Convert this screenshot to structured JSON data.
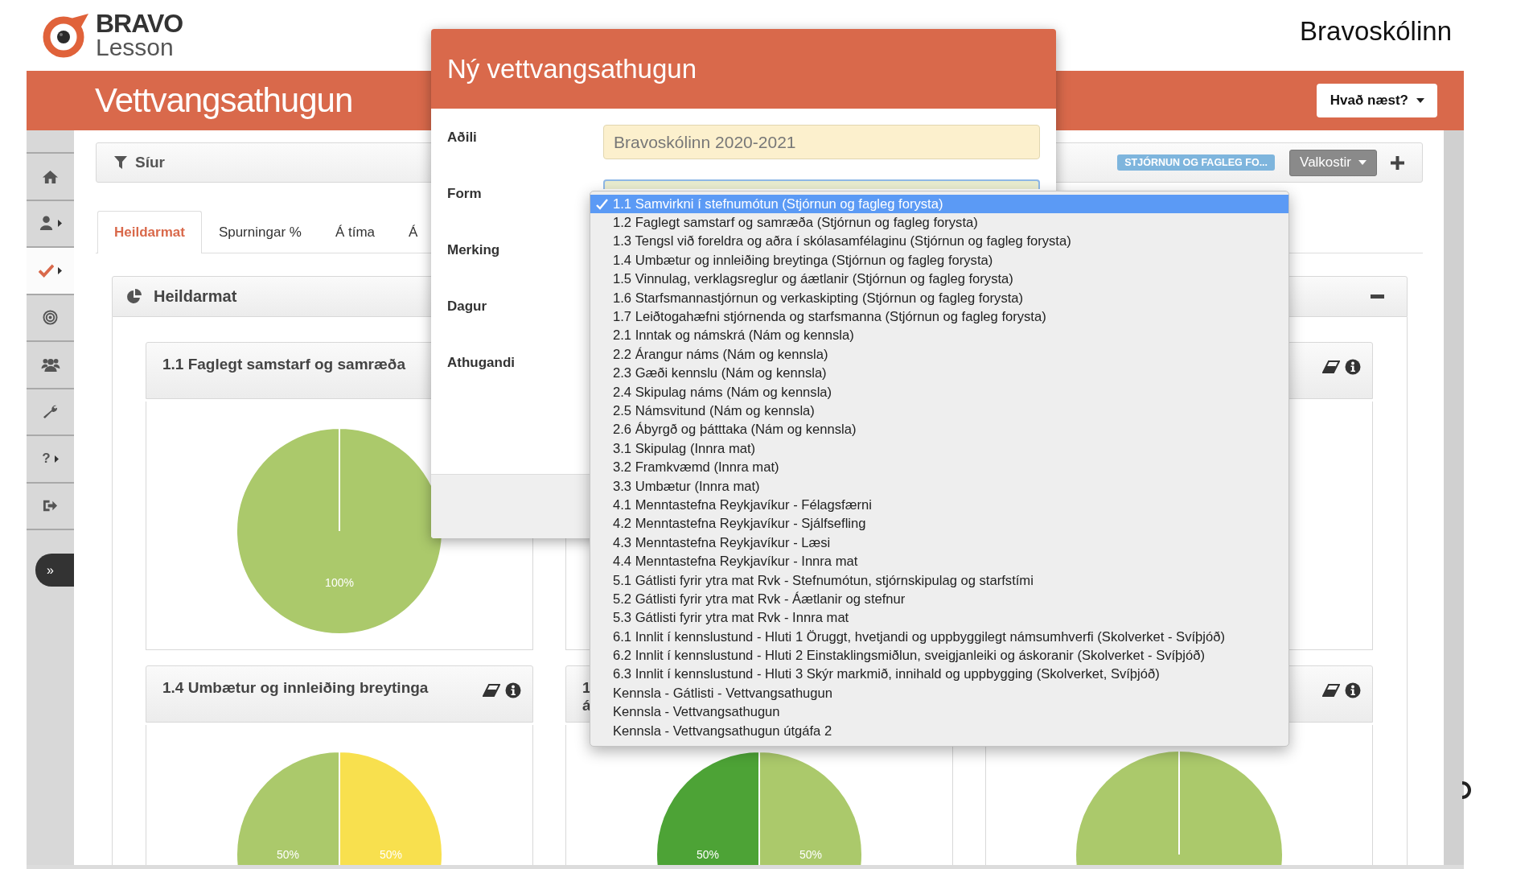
{
  "logo": {
    "line1": "BRAVO",
    "line2": "Lesson"
  },
  "school_name": "Bravoskólinn",
  "page_title": "Vettvangsathugun",
  "next_button": "Hvað næst?",
  "sidebar": {
    "items": [
      {
        "selected": false,
        "submenu": false
      },
      {
        "selected": false,
        "submenu": true
      },
      {
        "selected": true,
        "submenu": true
      },
      {
        "selected": false,
        "submenu": false
      },
      {
        "selected": false,
        "submenu": false
      },
      {
        "selected": false,
        "submenu": false
      },
      {
        "label": "?",
        "selected": false,
        "submenu": true
      },
      {
        "selected": false,
        "submenu": false
      }
    ],
    "expand_button": "»"
  },
  "filter_panel": {
    "title": "Síur",
    "tag": "STJÓRNUN OG FAGLEG FO...",
    "options_button": "Valkostir"
  },
  "tabs": [
    {
      "label": "Heildarmat",
      "selected": true
    },
    {
      "label": "Spurningar %",
      "selected": false
    },
    {
      "label": "Á tíma",
      "selected": false
    },
    {
      "label": "Á",
      "selected": false
    }
  ],
  "summary_panel": {
    "title": "Heildarmat",
    "cards": [
      {
        "kind": "pie_chart",
        "title": "1.1 Faglegt samstarf og samræða",
        "tools": false,
        "chart_data": {
          "type": "pie",
          "values": [
            100
          ],
          "colors": [
            "#abc96b"
          ],
          "value_labels": [
            "100%"
          ]
        }
      },
      {
        "kind": "empty"
      },
      {
        "kind": "empty",
        "tools": true
      },
      {
        "kind": "pie_chart",
        "title": "1.4 Umbætur og innleiðing breytinga",
        "tools": true,
        "chart_data": {
          "type": "pie",
          "values": [
            50,
            50
          ],
          "colors": [
            "#f8e04e",
            "#abc96b"
          ],
          "value_labels": [
            "50%",
            "50%"
          ]
        }
      },
      {
        "kind": "pie_chart",
        "title_fragments": [
          "1",
          "á"
        ],
        "tools": false,
        "chart_data": {
          "type": "pie",
          "values": [
            50,
            50
          ],
          "colors": [
            "#abc96b",
            "#4da336"
          ],
          "value_labels": [
            "50%",
            "50%"
          ]
        }
      },
      {
        "kind": "pie_picture",
        "tools": true
      }
    ]
  },
  "modal": {
    "title": "Ný vettvangsathugun",
    "fields": [
      {
        "label": "Aðili",
        "kind": "text",
        "value": "Bravoskólinn 2020-2021"
      },
      {
        "label": "Form",
        "kind": "select"
      },
      {
        "label": "Merking",
        "kind": "covered"
      },
      {
        "label": "Dagur",
        "kind": "covered"
      },
      {
        "label": "Athugandi",
        "kind": "covered"
      }
    ]
  },
  "dropdown": {
    "options": [
      {
        "label": "1.1 Samvirkni í stefnumótun (Stjórnun og fagleg forysta)",
        "selected": true
      },
      {
        "label": "1.2 Faglegt samstarf og samræða (Stjórnun og fagleg forysta)",
        "selected": false
      },
      {
        "label": "1.3 Tengsl við foreldra og aðra í skólasamfélaginu (Stjórnun og fagleg forysta)",
        "selected": false
      },
      {
        "label": "1.4 Umbætur og innleiðing breytinga (Stjórnun og fagleg forysta)",
        "selected": false
      },
      {
        "label": "1.5 Vinnulag, verklagsreglur og áætlanir (Stjórnun og fagleg forysta)",
        "selected": false
      },
      {
        "label": "1.6 Starfsmannastjórnun og verkaskipting (Stjórnun og fagleg forysta)",
        "selected": false
      },
      {
        "label": "1.7 Leiðtogahæfni stjórnenda og starfsmanna (Stjórnun og fagleg forysta)",
        "selected": false
      },
      {
        "label": "2.1 Inntak og námskrá (Nám og kennsla)",
        "selected": false
      },
      {
        "label": "2.2 Árangur náms (Nám og kennsla)",
        "selected": false
      },
      {
        "label": "2.3 Gæði kennslu (Nám og kennsla)",
        "selected": false
      },
      {
        "label": "2.4 Skipulag náms (Nám og kennsla)",
        "selected": false
      },
      {
        "label": "2.5 Námsvitund (Nám og kennsla)",
        "selected": false
      },
      {
        "label": "2.6 Ábyrgð og þátttaka (Nám og kennsla)",
        "selected": false
      },
      {
        "label": "3.1 Skipulag (Innra mat)",
        "selected": false
      },
      {
        "label": "3.2 Framkvæmd (Innra mat)",
        "selected": false
      },
      {
        "label": "3.3 Umbætur (Innra mat)",
        "selected": false
      },
      {
        "label": "4.1 Menntastefna Reykjavíkur - Félagsfærni",
        "selected": false
      },
      {
        "label": "4.2 Menntastefna Reykjavíkur - Sjálfsefling",
        "selected": false
      },
      {
        "label": "4.3 Menntastefna Reykjavíkur - Læsi",
        "selected": false
      },
      {
        "label": "4.4 Menntastefna Reykjavíkur - Innra mat",
        "selected": false
      },
      {
        "label": "5.1 Gátlisti fyrir ytra mat Rvk - Stefnumótun, stjórnskipulag og starfstími",
        "selected": false
      },
      {
        "label": "5.2 Gátlisti fyrir ytra mat Rvk - Áætlanir og stefnur",
        "selected": false
      },
      {
        "label": "5.3 Gátlisti fyrir ytra mat Rvk - Innra mat",
        "selected": false
      },
      {
        "label": "6.1 Innlit í kennslustund - Hluti 1 Öruggt, hvetjandi og uppbyggilegt námsumhverfi (Skolverket - Svíþjóð)",
        "selected": false
      },
      {
        "label": "6.2 Innlit í kennslustund - Hluti 2 Einstaklingsmiðlun, sveigjanleiki og áskoranir (Skolverket - Svíþjóð)",
        "selected": false
      },
      {
        "label": "6.3 Innlit í kennslustund - Hluti 3 Skýr markmið, innihald og uppbygging (Skolverket, Svíþjóð)",
        "selected": false
      },
      {
        "label": "Kennsla - Gátlisti - Vettvangsathugun",
        "selected": false
      },
      {
        "label": "Kennsla - Vettvangsathugun",
        "selected": false
      },
      {
        "label": "Kennsla - Vettvangsathugun útgáfa 2",
        "selected": false
      }
    ]
  }
}
